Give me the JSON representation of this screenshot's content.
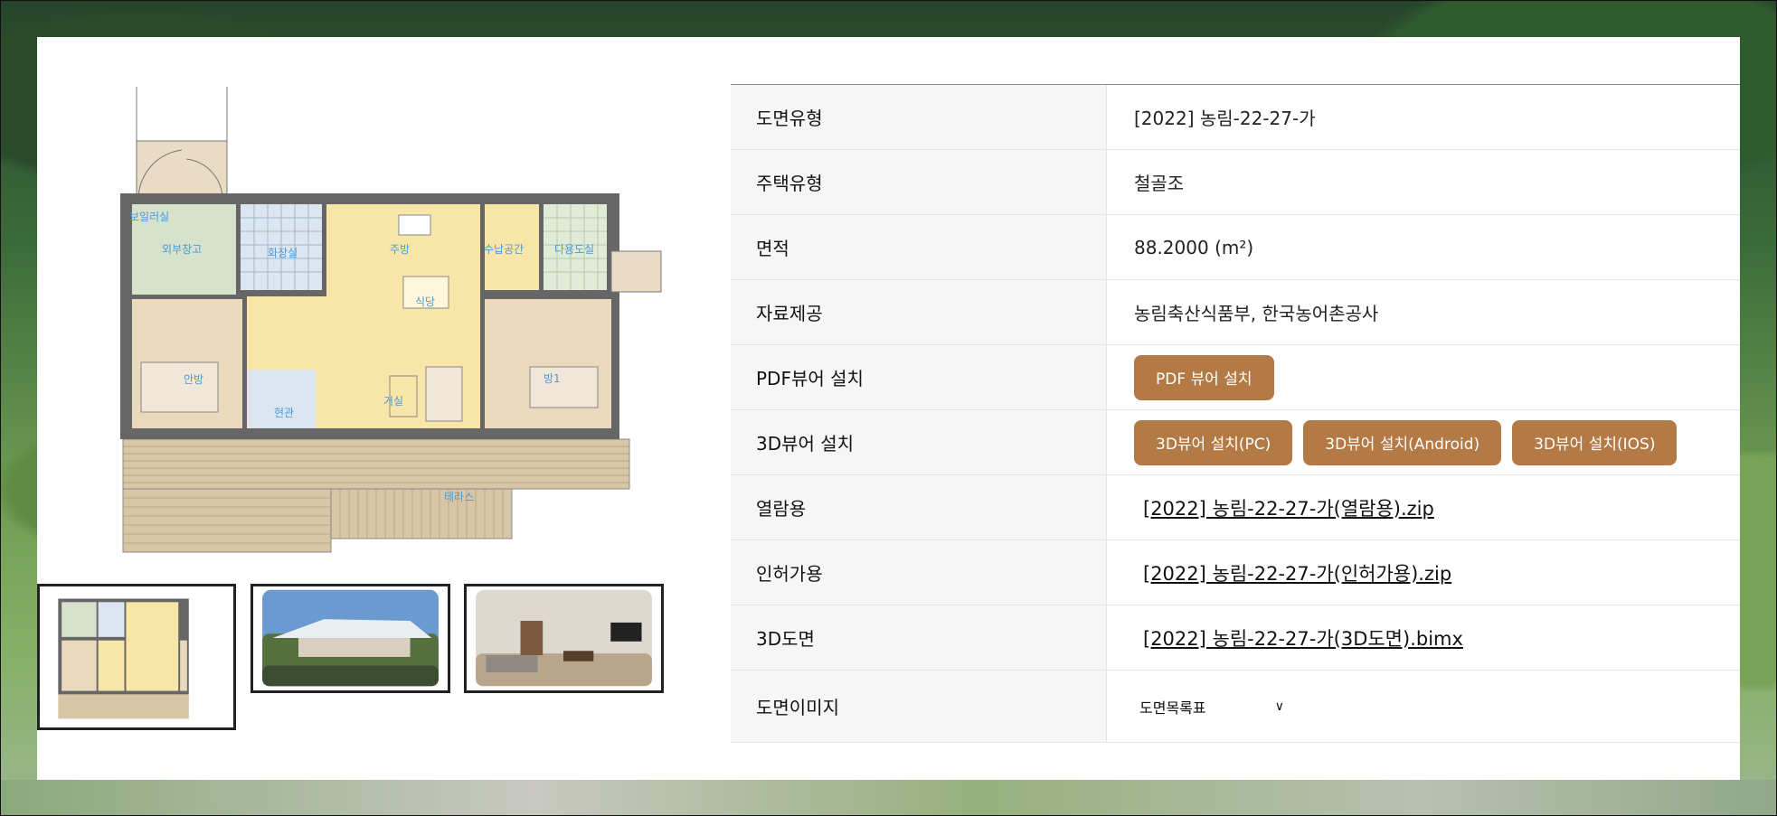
{
  "table": {
    "rows": [
      {
        "label": "도면유형",
        "value": "[2022] 농림-22-27-가"
      },
      {
        "label": "주택유형",
        "value": "철골조"
      },
      {
        "label": "면적",
        "value": "88.2000 (m²)"
      },
      {
        "label": "자료제공",
        "value": "농림축산식품부, 한국농어촌공사"
      },
      {
        "label": "PDF뷰어 설치",
        "buttons": [
          "PDF 뷰어 설치"
        ]
      },
      {
        "label": "3D뷰어 설치",
        "buttons": [
          "3D뷰어 설치(PC)",
          "3D뷰어 설치(Android)",
          "3D뷰어 설치(IOS)"
        ]
      },
      {
        "label": "열람용",
        "link": "[2022] 농림-22-27-가(열람용).zip"
      },
      {
        "label": "인허가용",
        "link": "[2022] 농림-22-27-가(인허가용).zip"
      },
      {
        "label": "3D도면",
        "link": "[2022] 농림-22-27-가(3D도면).bimx"
      },
      {
        "label": "도면이미지",
        "select": "도면목록표"
      }
    ]
  },
  "plan": {
    "rooms": [
      "보일러실",
      "외부창고",
      "화장실",
      "주방",
      "수납공간",
      "다용도실",
      "식당",
      "안방",
      "거실",
      "현관",
      "방1",
      "테라스"
    ]
  },
  "icons": {
    "select_chevron": "chevron-down-icon"
  },
  "colors": {
    "accent": "#b47a45",
    "header_bg": "#f6f6f6"
  }
}
